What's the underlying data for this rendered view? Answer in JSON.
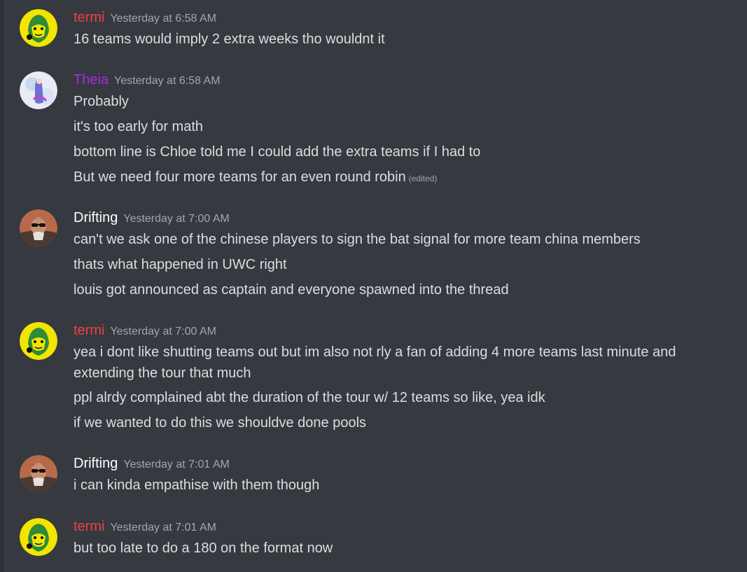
{
  "colors": {
    "background": "#36393f",
    "text": "#dcddde",
    "timestamp": "#a3a6aa",
    "termi": "#ed4245",
    "theia": "#a42ee3",
    "drifting": "#ffffff"
  },
  "groups": [
    {
      "author": "termi",
      "timestamp": "Yesterday at 6:58 AM",
      "avatar_icon": "yellow-face-avatar",
      "lines": [
        {
          "text": "16 teams would imply 2 extra weeks tho wouldnt it"
        }
      ]
    },
    {
      "author": "Theia",
      "timestamp": "Yesterday at 6:58 AM",
      "avatar_icon": "anime-character-avatar",
      "lines": [
        {
          "text": "Probably"
        },
        {
          "text": "it's too early for math"
        },
        {
          "text": "bottom line is Chloe told me I could add the extra teams if I had to"
        },
        {
          "text": "But we need four more teams for an even round robin",
          "edited": "(edited)"
        }
      ]
    },
    {
      "author": "Drifting",
      "timestamp": "Yesterday at 7:00 AM",
      "avatar_icon": "man-with-sunglasses-avatar",
      "lines": [
        {
          "text": "can't we ask one of the chinese players to sign the bat signal for more team china members"
        },
        {
          "text": "thats what happened in UWC right"
        },
        {
          "text": "louis got announced as captain and everyone spawned into the thread"
        }
      ]
    },
    {
      "author": "termi",
      "timestamp": "Yesterday at 7:00 AM",
      "avatar_icon": "yellow-face-avatar",
      "lines": [
        {
          "text": "yea i dont like shutting teams out but im also not rly a fan of adding 4 more teams last minute and extending the tour that much"
        },
        {
          "text": "ppl alrdy complained abt the duration of the tour w/ 12 teams so like, yea idk"
        },
        {
          "text": "if we wanted to do this we shouldve done pools"
        }
      ]
    },
    {
      "author": "Drifting",
      "timestamp": "Yesterday at 7:01 AM",
      "avatar_icon": "man-with-sunglasses-avatar",
      "lines": [
        {
          "text": "i can kinda empathise with them though"
        }
      ]
    },
    {
      "author": "termi",
      "timestamp": "Yesterday at 7:01 AM",
      "avatar_icon": "yellow-face-avatar",
      "lines": [
        {
          "text": "but too late to do a 180 on the format now"
        }
      ]
    }
  ]
}
